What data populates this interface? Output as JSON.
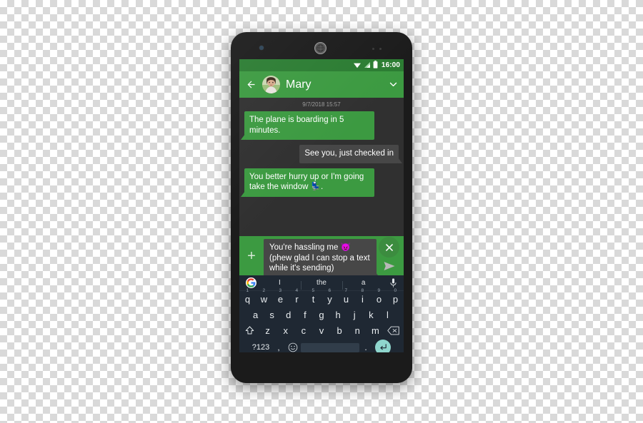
{
  "device": {
    "name": "android-smartphone",
    "front_camera": "camera-icon",
    "speaker": "speaker-grille-icon",
    "sensors": "proximity-sensor-icon"
  },
  "status_bar": {
    "wifi_icon": "wifi-icon",
    "signal_icon": "cell-signal-icon",
    "battery_icon": "battery-icon",
    "time": "16:00",
    "background_color": "#2b7c32"
  },
  "app_bar": {
    "back_icon": "back-arrow-icon",
    "avatar": "contact-avatar",
    "contact_name": "Mary",
    "chevron_icon": "chevron-down-icon",
    "background_color": "#3c9a41"
  },
  "conversation": {
    "timestamp": "9/7/2018 15:57",
    "background_color": "#303030",
    "outgoing_bubble_color": "#3c9a41",
    "incoming_bubble_color": "#474747",
    "messages": [
      {
        "direction": "out",
        "text": "The plane is boarding in 5 minutes."
      },
      {
        "direction": "in",
        "text": "See you, just checked in"
      },
      {
        "direction": "out",
        "text": "You better hurry up or I'm going take the window ",
        "emoji": "💺",
        "emoji_name": "seat-emoji",
        "suffix": "."
      }
    ]
  },
  "composer": {
    "attach_label": "+",
    "attach_icon": "add-attachment-icon",
    "sending_message": {
      "line1_pre": "You're hassling me ",
      "line1_emoji": "😈",
      "line1_emoji_name": "smiling-devil-emoji",
      "line2": "(phew glad I can stop a text while it's sending)"
    },
    "cancel_icon": "close-x-icon",
    "send_icon": "send-arrow-icon",
    "cancel_button_color": "#3c8c3f"
  },
  "keyboard": {
    "background_color": "#1f2833",
    "google_icon": "google-logo-icon",
    "mic_icon": "microphone-icon",
    "suggestions": [
      "I",
      "the",
      "a"
    ],
    "row1": [
      {
        "key": "q",
        "sup": "1"
      },
      {
        "key": "w",
        "sup": "2"
      },
      {
        "key": "e",
        "sup": "3"
      },
      {
        "key": "r",
        "sup": "4"
      },
      {
        "key": "t",
        "sup": "5"
      },
      {
        "key": "y",
        "sup": "6"
      },
      {
        "key": "u",
        "sup": "7"
      },
      {
        "key": "i",
        "sup": "8"
      },
      {
        "key": "o",
        "sup": "9"
      },
      {
        "key": "p",
        "sup": "0"
      }
    ],
    "row2": [
      "a",
      "s",
      "d",
      "f",
      "g",
      "h",
      "j",
      "k",
      "l"
    ],
    "row3": {
      "shift_icon": "shift-key-icon",
      "keys": [
        "z",
        "x",
        "c",
        "v",
        "b",
        "n",
        "m"
      ],
      "backspace_icon": "backspace-key-icon"
    },
    "row4": {
      "symbols_label": "?123",
      "comma_label": ",",
      "emoji_icon": "emoji-key-icon",
      "space_label": "",
      "period_label": ".",
      "enter_icon": "enter-key-icon",
      "enter_color": "#8fd6cd"
    }
  }
}
